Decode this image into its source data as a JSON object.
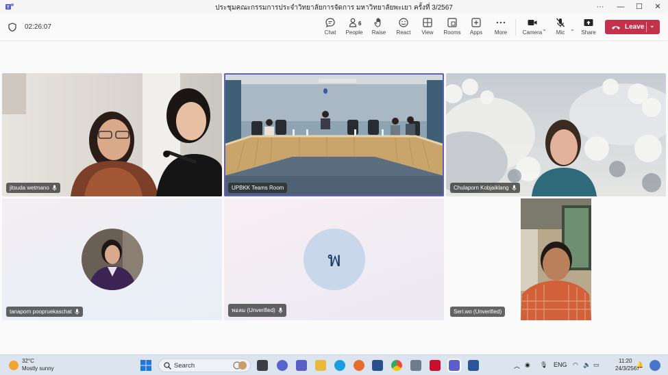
{
  "window": {
    "title": "ประชุมคณะกรรมการประจำวิทยาลัยการจัดการ มหาวิทยาลัยพะเยา ครั้งที่ 3/2567",
    "minimize": "—",
    "maximize": "☐",
    "close": "✕",
    "more": "···"
  },
  "toolbar": {
    "timer": "02:26:07",
    "people_count": "6",
    "items": [
      {
        "label": "Chat",
        "icon": "chat-icon"
      },
      {
        "label": "People",
        "icon": "people-icon"
      },
      {
        "label": "Raise",
        "icon": "raise-hand-icon"
      },
      {
        "label": "React",
        "icon": "react-icon"
      },
      {
        "label": "View",
        "icon": "view-icon"
      },
      {
        "label": "Rooms",
        "icon": "rooms-icon"
      },
      {
        "label": "Apps",
        "icon": "apps-icon"
      },
      {
        "label": "More",
        "icon": "more-icon"
      },
      {
        "label": "Camera",
        "icon": "camera-icon"
      },
      {
        "label": "Mic",
        "icon": "mic-off-icon"
      },
      {
        "label": "Share",
        "icon": "share-icon"
      }
    ],
    "leave_label": "Leave",
    "leave_color": "#c4314b"
  },
  "participants": [
    {
      "name": "jitsuda wetmano",
      "type": "video"
    },
    {
      "name": "UPBKK Teams Room",
      "type": "video",
      "selected": true
    },
    {
      "name": "Chulaporn Kobjaiklang",
      "type": "video"
    },
    {
      "name": "tanaporn poopruekaschat",
      "type": "avatar"
    },
    {
      "name": "พอลม (Unverified)",
      "type": "initial",
      "initial": "พ"
    },
    {
      "name": "Seri.wo (Unverified)",
      "type": "video"
    }
  ],
  "taskbar": {
    "weather_temp": "32°C",
    "weather_desc": "Mostly sunny",
    "search_label": "Search",
    "language": "ENG",
    "time": "11:20",
    "date": "24/3/2567"
  },
  "colors": {
    "accent": "#5b5fc7",
    "leave": "#c4314b",
    "taskbar": "#dbe4ef"
  }
}
